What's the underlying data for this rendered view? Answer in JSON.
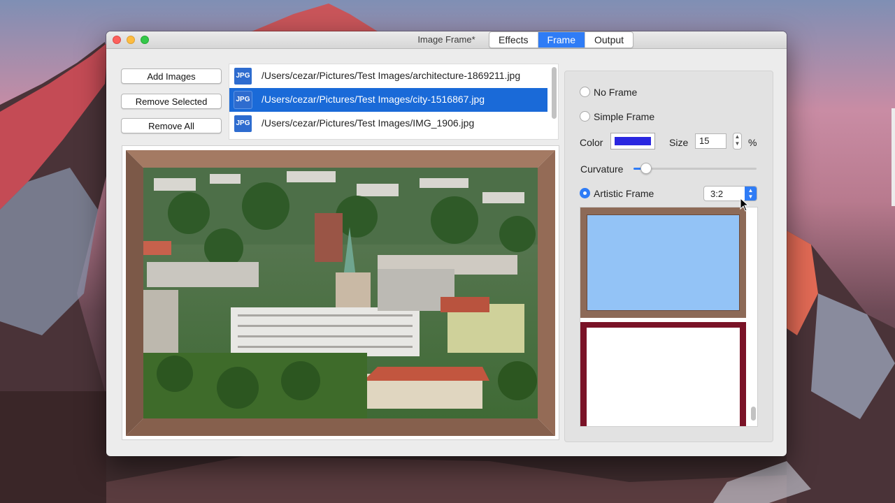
{
  "window": {
    "title": "Image Frame*"
  },
  "buttons": {
    "add_images": "Add Images",
    "remove_selected": "Remove Selected",
    "remove_all": "Remove All"
  },
  "files": [
    {
      "badge": "JPG",
      "path": "/Users/cezar/Pictures/Test Images/architecture-1869211.jpg",
      "selected": false
    },
    {
      "badge": "JPG",
      "path": "/Users/cezar/Pictures/Test Images/city-1516867.jpg",
      "selected": true
    },
    {
      "badge": "JPG",
      "path": "/Users/cezar/Pictures/Test Images/IMG_1906.jpg",
      "selected": false
    }
  ],
  "tabs": {
    "effects": "Effects",
    "frame": "Frame",
    "output": "Output",
    "active": "Frame"
  },
  "frame_options": {
    "no_frame": "No Frame",
    "simple_frame": "Simple Frame",
    "artistic_frame": "Artistic Frame",
    "selected": "Artistic Frame"
  },
  "simple": {
    "color_label": "Color",
    "color_value": "#2a27e0",
    "size_label": "Size",
    "size_value": "15",
    "size_unit": "%",
    "curvature_label": "Curvature",
    "curvature_value": 0.1
  },
  "artistic": {
    "ratio": "3:2"
  },
  "colors": {
    "accent": "#2f7cf6",
    "selection": "#1a6ad8",
    "frame_brown": "#8d6a57",
    "frame_red": "#7a1327",
    "thumb_sky": "#93c3f6"
  }
}
